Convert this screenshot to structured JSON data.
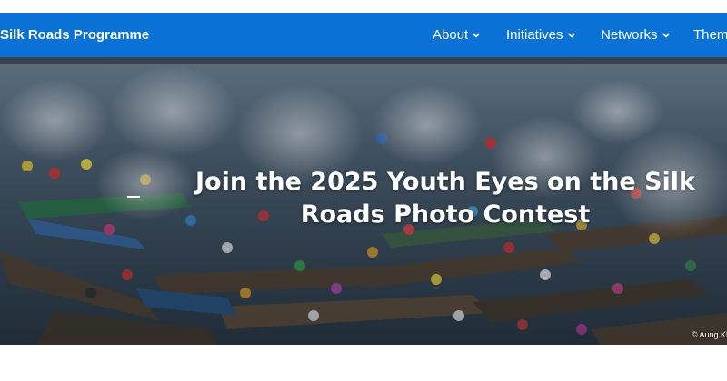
{
  "header": {
    "brand": "Silk Roads Programme",
    "nav": [
      {
        "label": "About"
      },
      {
        "label": "Initiatives"
      },
      {
        "label": "Networks"
      },
      {
        "label": "Them"
      }
    ],
    "background_color": "#0a72d6"
  },
  "hero": {
    "title_line1": "Join the 2025 Youth Eyes on the Silk",
    "title_line2": "Roads Photo Contest",
    "credit": "© Aung Kh"
  }
}
